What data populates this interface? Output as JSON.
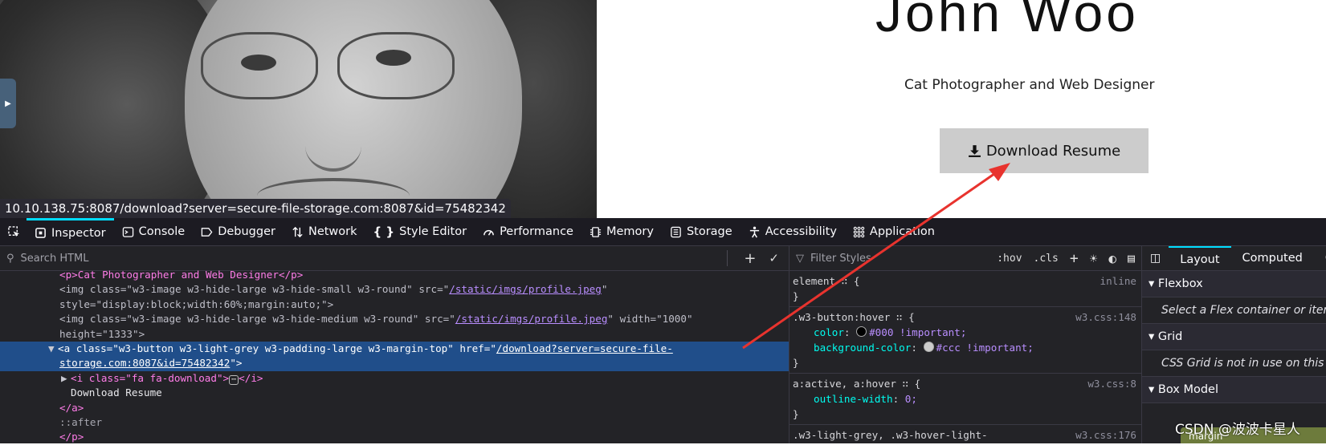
{
  "page": {
    "name": "John Woo",
    "subtitle": "Cat Photographer and Web Designer",
    "download_label": "Download Resume",
    "status_url": "10.10.138.75:8087/download?server=secure-file-storage.com:8087&id=75482342"
  },
  "devtools": {
    "tools": [
      {
        "label": "Inspector",
        "icon": "inspector-icon"
      },
      {
        "label": "Console",
        "icon": "console-icon"
      },
      {
        "label": "Debugger",
        "icon": "debugger-icon"
      },
      {
        "label": "Network",
        "icon": "network-icon"
      },
      {
        "label": "Style Editor",
        "icon": "style-editor-icon"
      },
      {
        "label": "Performance",
        "icon": "performance-icon"
      },
      {
        "label": "Memory",
        "icon": "memory-icon"
      },
      {
        "label": "Storage",
        "icon": "storage-icon"
      },
      {
        "label": "Accessibility",
        "icon": "accessibility-icon"
      },
      {
        "label": "Application",
        "icon": "application-icon"
      }
    ],
    "search_html_placeholder": "Search HTML",
    "filter_styles_placeholder": "Filter Styles",
    "rule_tools": {
      "hov": ":hov",
      "cls": ".cls"
    },
    "markup": {
      "l1_text": "<p>Cat Photographer and Web Designer</p>",
      "l2a": "<img class=\"w3-image w3-hide-large w3-hide-small w3-round\" src=\"",
      "l2_link": "/static/imgs/profile.jpeg",
      "l2b": "\"",
      "l3": "style=\"display:block;width:60%;margin:auto;\">",
      "l4a": "<img class=\"w3-image w3-hide-large w3-hide-medium w3-round\" src=\"",
      "l4_link": "/static/imgs/profile.jpeg",
      "l4b": "\" width=\"1000\"",
      "l5": "height=\"1333\">",
      "l6a": "<a class=\"w3-button w3-light-grey w3-padding-large w3-margin-top\" href=\"",
      "l6_link": "/download?server=secure-file-",
      "l7_link": "storage.com:8087&id=75482342",
      "l7b": "\">",
      "l8a": "<i class=\"fa fa-download\">",
      "l8b": "</i>",
      "l9": "Download Resume",
      "l10": "</a>",
      "l11": "::after",
      "l12": "</p>"
    },
    "rules": {
      "element_selector": "element",
      "element_source": "inline",
      "r2_selector": ".w3-button:hover",
      "r2_source": "w3.css:148",
      "r2_p1_name": "color",
      "r2_p1_value": "#000 !important;",
      "r2_p2_name": "background-color",
      "r2_p2_value": "#ccc !important;",
      "r3_selector": "a:active, a:hover",
      "r3_source": "w3.css:8",
      "r3_p1_name": "outline-width",
      "r3_p1_value": "0;",
      "r4_selector": ".w3-light-grey, .w3-hover-light-",
      "r4_source": "w3.css:176"
    },
    "layout_panel": {
      "tabs": [
        "Layout",
        "Computed",
        "C"
      ],
      "flexbox": "Flexbox",
      "flexbox_note": "Select a Flex container or item to continue.",
      "grid": "Grid",
      "grid_note": "CSS Grid is not in use on this page",
      "box_model": "Box Model",
      "margin_label": "margin"
    }
  },
  "watermark": "CSDN @波波卡星人",
  "colors": {
    "accent": "#00ddff",
    "selected_row": "#204e8a",
    "annotation_arrow": "#e8332e",
    "button_bg": "#cccccc"
  }
}
